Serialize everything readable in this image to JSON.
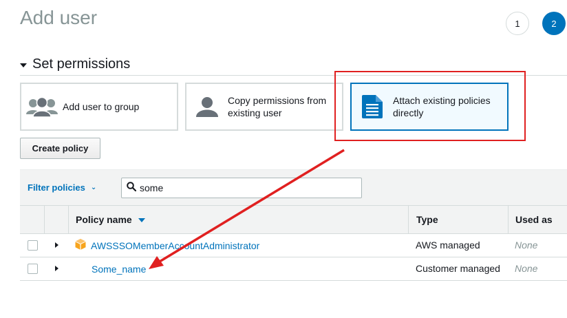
{
  "page": {
    "title": "Add user"
  },
  "steps": [
    {
      "label": "1",
      "active": false
    },
    {
      "label": "2",
      "active": true
    }
  ],
  "permissions": {
    "section_title": "Set permissions",
    "options": [
      {
        "label": "Add user to group",
        "icon": "group-icon",
        "selected": false
      },
      {
        "label": "Copy permissions from existing user",
        "icon": "user-icon",
        "selected": false
      },
      {
        "label": "Attach existing policies directly",
        "icon": "document-icon",
        "selected": true
      }
    ],
    "create_policy_label": "Create policy"
  },
  "filter": {
    "label": "Filter policies",
    "search_value": "some",
    "search_icon": "search-icon"
  },
  "table": {
    "columns": {
      "policy_name": "Policy name",
      "type": "Type",
      "used_as": "Used as"
    },
    "rows": [
      {
        "policy_name": "AWSSSOMemberAccountAdministrator",
        "type": "AWS managed",
        "used_as": "None",
        "icon": "aws-managed-cube-icon"
      },
      {
        "policy_name": "Some_name",
        "type": "Customer managed",
        "used_as": "None"
      }
    ]
  },
  "colors": {
    "accent": "#0073bb",
    "annotation": "#e02020",
    "selected_card_bg": "#f1faff",
    "aws_managed_icon": "#f7a41d"
  }
}
